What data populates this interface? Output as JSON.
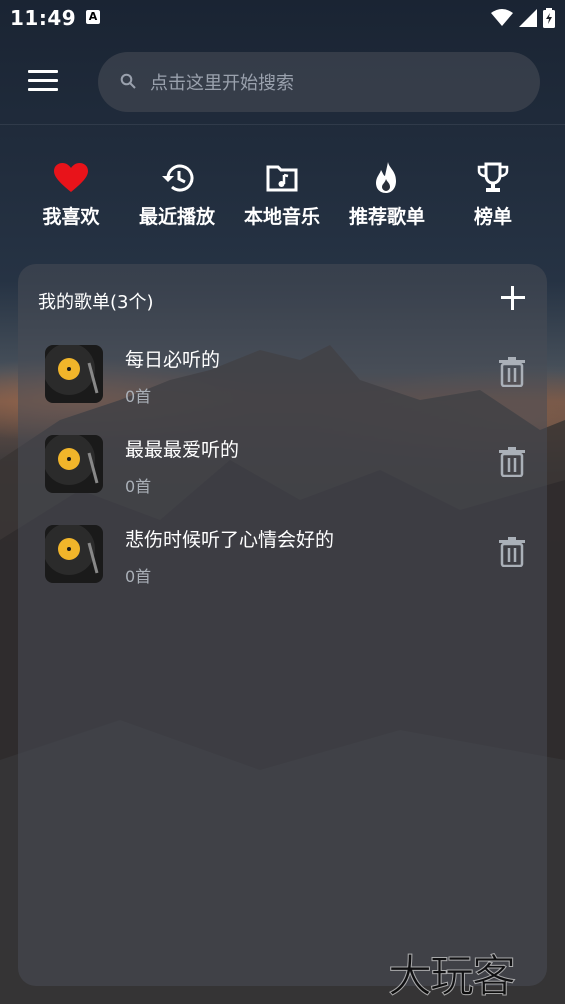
{
  "status": {
    "time": "11:49",
    "app_badge": "A"
  },
  "search": {
    "placeholder": "点击这里开始搜索"
  },
  "quick_actions": [
    {
      "label": "我喜欢",
      "icon": "heart-icon"
    },
    {
      "label": "最近播放",
      "icon": "history-icon"
    },
    {
      "label": "本地音乐",
      "icon": "music-folder-icon"
    },
    {
      "label": "推荐歌单",
      "icon": "fire-icon"
    },
    {
      "label": "榜单",
      "icon": "trophy-icon"
    }
  ],
  "playlists": {
    "title": "我的歌单(3个)",
    "items": [
      {
        "name": "每日必听的",
        "count": "0首"
      },
      {
        "name": "最最最爱听的",
        "count": "0首"
      },
      {
        "name": "悲伤时候听了心情会好的",
        "count": "0首"
      }
    ]
  },
  "watermark": "大玩客",
  "colors": {
    "accent_heart": "#e8131a",
    "panel": "#484c56"
  }
}
